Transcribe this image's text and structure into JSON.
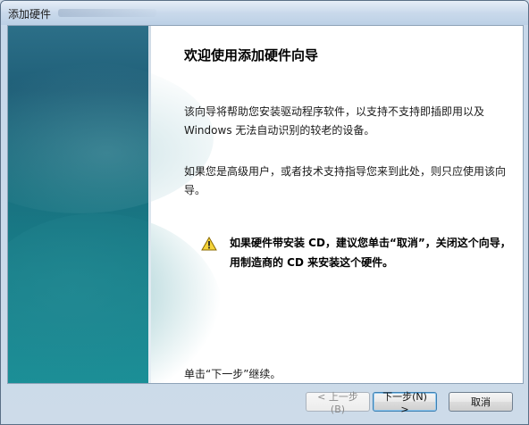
{
  "window": {
    "title": "添加硬件"
  },
  "main": {
    "heading": "欢迎使用添加硬件向导",
    "paragraph1": "该向导将帮助您安装驱动程序软件，以支持不支持即插即用以及 Windows 无法自动识别的较老的设备。",
    "paragraph2": "如果您是高级用户，或者技术支持指导您来到此处，则只应使用该向导。",
    "warning": "如果硬件带安装 CD，建议您单击“取消”，关闭这个向导，用制造商的 CD 来安装这个硬件。",
    "footer_text": "单击“下一步”继续。"
  },
  "buttons": {
    "back": "< 上一步(B)",
    "next": "下一步(N) >",
    "cancel": "取消"
  },
  "icons": {
    "warning": "warning-icon"
  },
  "colors": {
    "sidebar_top": "#2c6f88",
    "sidebar_bottom": "#1a8f97",
    "default_button_border": "#3c7fb1"
  }
}
